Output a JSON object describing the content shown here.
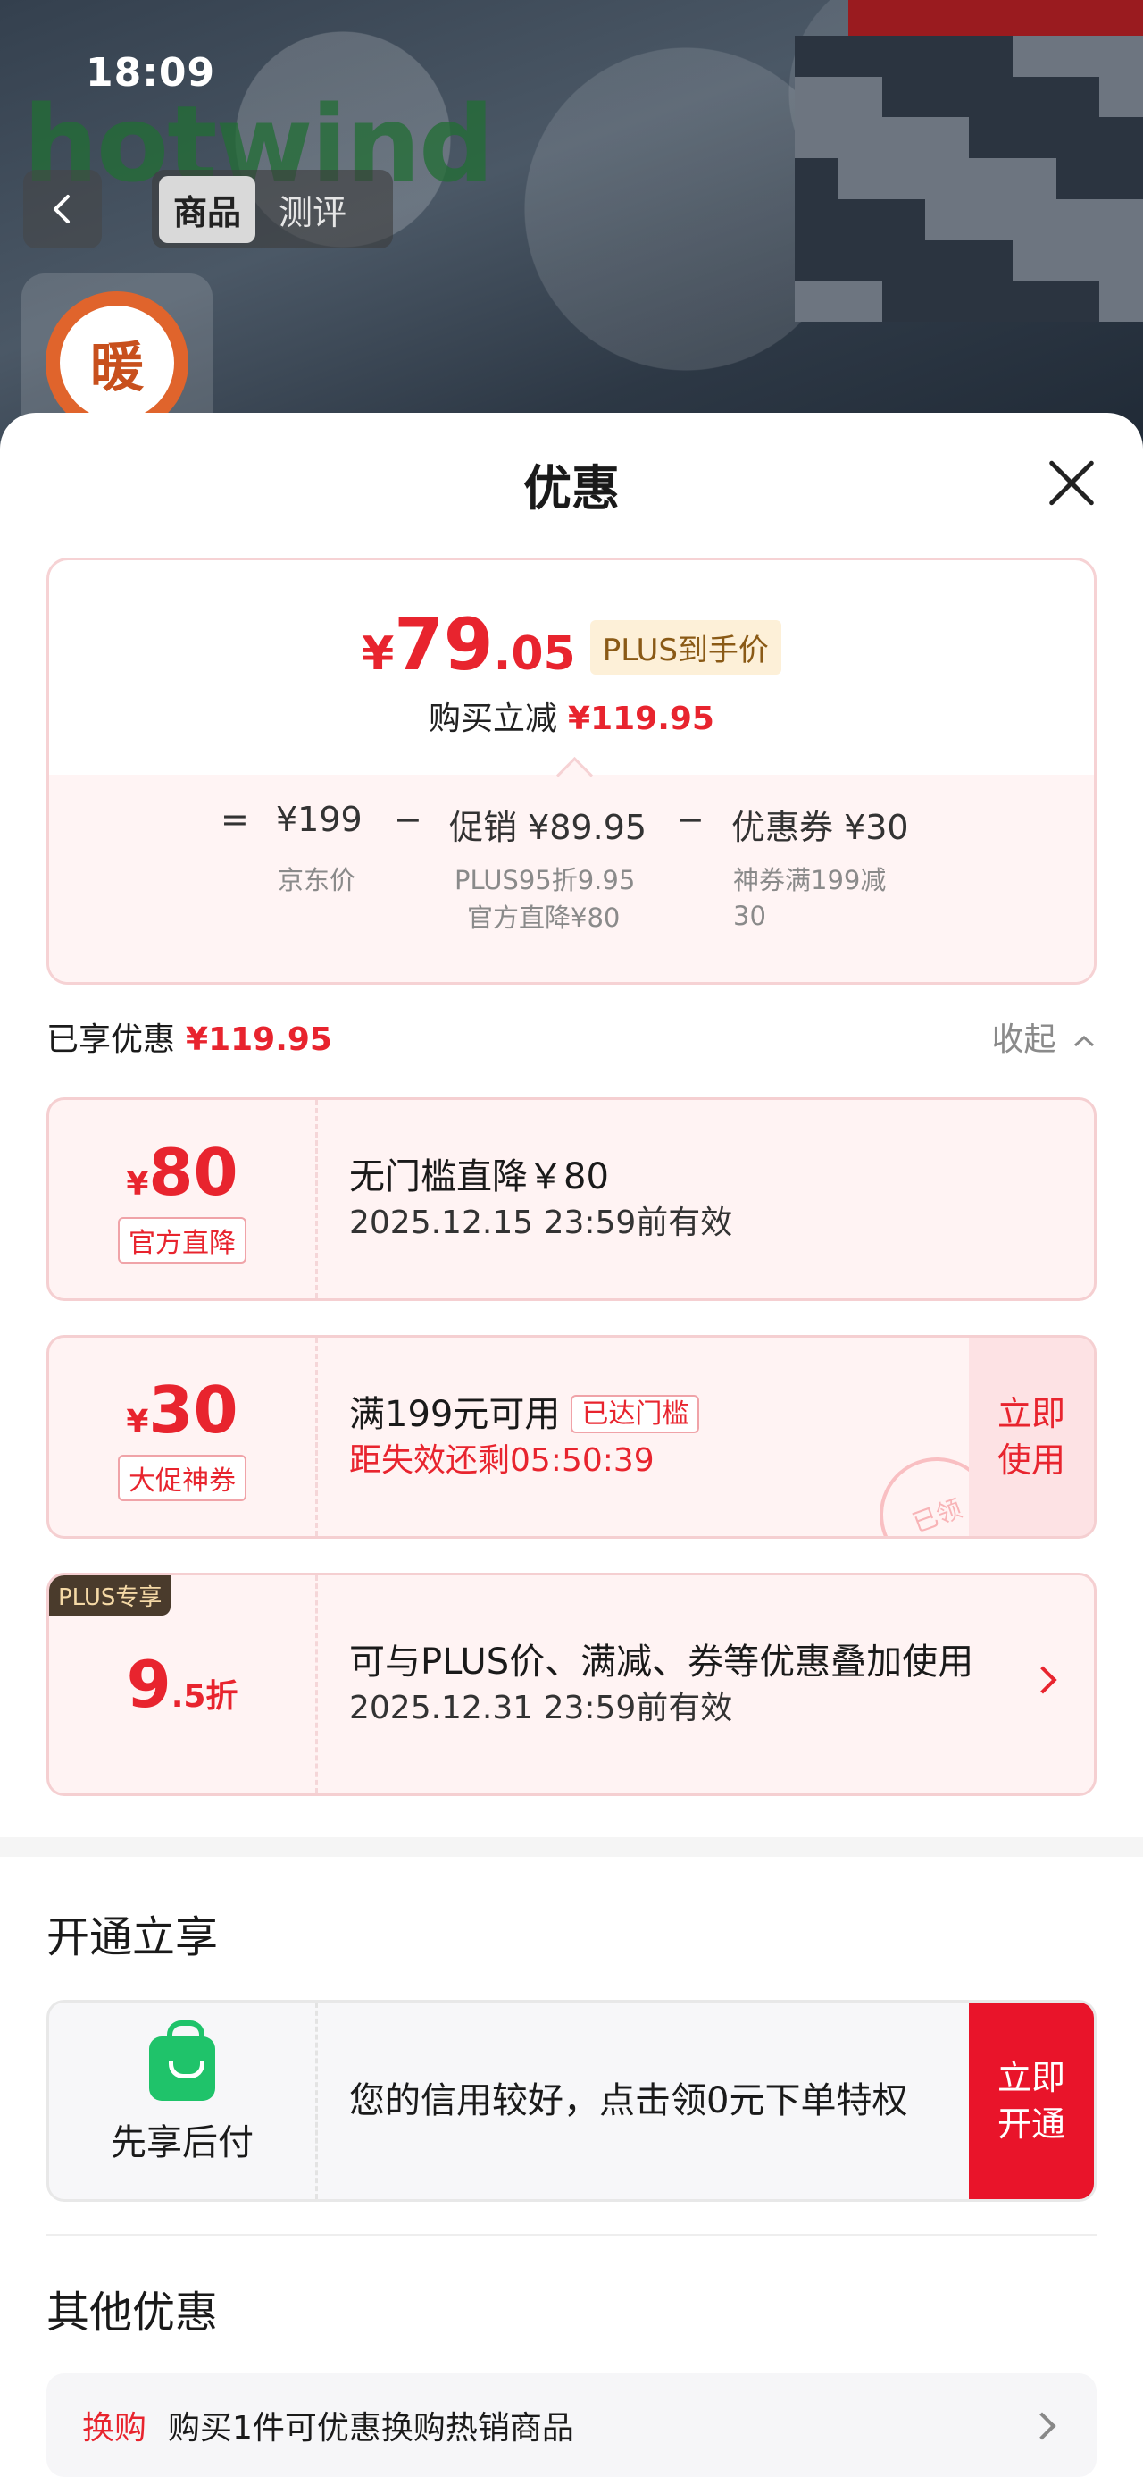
{
  "status_bar": {
    "time": "18:09"
  },
  "product_header": {
    "brand": "hotwind",
    "tabs": [
      {
        "label": "商品",
        "active": true
      },
      {
        "label": "测评",
        "active": false
      }
    ],
    "shop_logo_char": "暖"
  },
  "sheet": {
    "title": "优惠",
    "summary": {
      "currency": "¥",
      "price_int": "79",
      "price_dec": ".05",
      "plus_label": "PLUS到手价",
      "reduce_label": "购买立减",
      "reduce_value": "¥119.95",
      "formula": {
        "eq": "=",
        "jd_price": "¥199",
        "minus1": "−",
        "promo": "促销 ¥89.95",
        "minus2": "−",
        "coupon": "优惠券 ¥30",
        "jd_price_label": "京东价",
        "promo_sub1": "PLUS95折9.95",
        "promo_sub2": "官方直降¥80",
        "coupon_sub1": "神券满199减",
        "coupon_sub2": "30"
      }
    },
    "enjoyed": {
      "label": "已享优惠",
      "value": "¥119.95",
      "collapse": "收起"
    },
    "coupons": [
      {
        "yen": "¥",
        "amount": "80",
        "tag": "官方直降",
        "title": "无门槛直降￥80",
        "sub": "2025.12.15 23:59前有效"
      },
      {
        "yen": "¥",
        "amount": "30",
        "tag": "大促神券",
        "title": "满199元可用",
        "reached": "已达门槛",
        "sub": "距失效还剩05:50:39",
        "action": "立即\n使用",
        "stamp": "已领"
      },
      {
        "badge": "PLUS专享",
        "amount": "9",
        "amount_suffix": ".5折",
        "title": "可与PLUS价、满减、券等优惠叠加使用",
        "sub": "2025.12.31 23:59前有效"
      }
    ],
    "open_section": {
      "title": "开通立享",
      "paylater_label": "先享后付",
      "paylater_text": "您的信用较好，点击领0元下单特权",
      "action": "立即\n开通"
    },
    "other_section": {
      "title": "其他优惠",
      "swap_tag": "换购",
      "swap_text": "购买1件可优惠换购热销商品"
    }
  },
  "colors": {
    "accent_red": "#e8242e",
    "plus_gold": "#8a5a16",
    "green": "#1fc36a"
  }
}
